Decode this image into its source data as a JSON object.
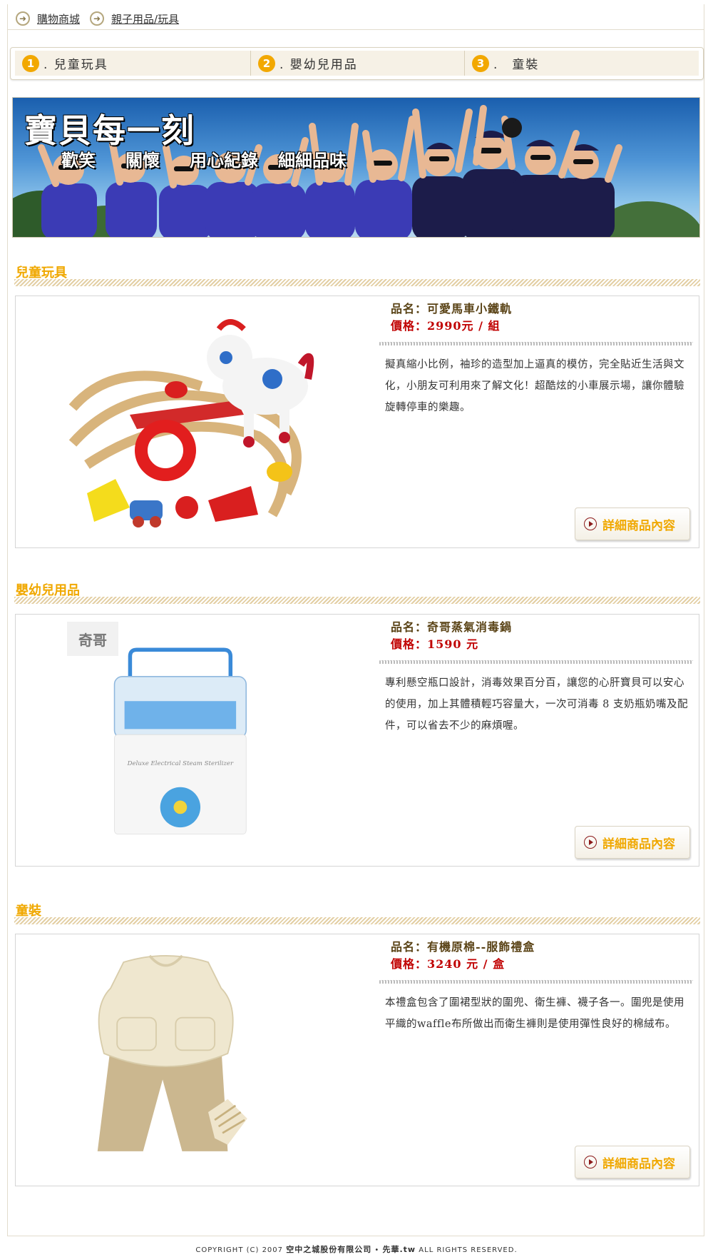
{
  "breadcrumb": [
    "購物商城",
    "親子用品/玩具"
  ],
  "tabs": [
    {
      "num": "1",
      "label": ". 兒童玩具"
    },
    {
      "num": "2",
      "label": ". 嬰幼兒用品"
    },
    {
      "num": "3",
      "label": ".　童裝"
    }
  ],
  "banner": {
    "title": "寶貝每一刻",
    "subtitles": [
      "歡笑",
      "關懷",
      "用心紀錄",
      "細細品味"
    ]
  },
  "sections": [
    {
      "title": "兒童玩具",
      "name": "品名：可愛馬車小鐵軌",
      "price": "價格：2990元 / 組",
      "description": "擬真縮小比例，袖珍的造型加上逼真的模仿，完全貼近生活與文化，小朋友可利用來了解文化！超酷炫的小車展示場，讓你體驗旋轉停車的樂趣。",
      "button": "詳細商品內容"
    },
    {
      "title": "嬰幼兒用品",
      "name": "品名：奇哥蒸氣消毒鍋",
      "price": "價格：1590 元",
      "description": "專利懸空瓶口設計，消毒效果百分百，讓您的心肝寶貝可以安心的使用，加上其體積輕巧容量大，一次可消毒 8 支奶瓶奶嘴及配件，可以省去不少的麻煩喔。",
      "button": "詳細商品內容"
    },
    {
      "title": "童裝",
      "name": "品名：有機原棉--服飾禮盒",
      "price": "價格：3240 元 / 盒",
      "description": "本禮盒包含了圍裙型狀的圍兜、衛生褲、襪子各一。圍兜是使用平織的waffle布所做出而衛生褲則是使用彈性良好的棉絨布。",
      "button": "詳細商品內容"
    }
  ],
  "sterilizer_label": "Deluxe Electrical Steam Sterilizer",
  "brand_logo": "奇哥",
  "footer": {
    "prefix": "COPYRIGHT (C) 2007",
    "company": "空中之城股份有限公司",
    "sep": "•",
    "site": "先華.tw",
    "suffix": "ALL RIGHTS RESERVED."
  },
  "colors": {
    "accent": "#f0a800",
    "price": "#c00000",
    "name": "#5a4316"
  }
}
